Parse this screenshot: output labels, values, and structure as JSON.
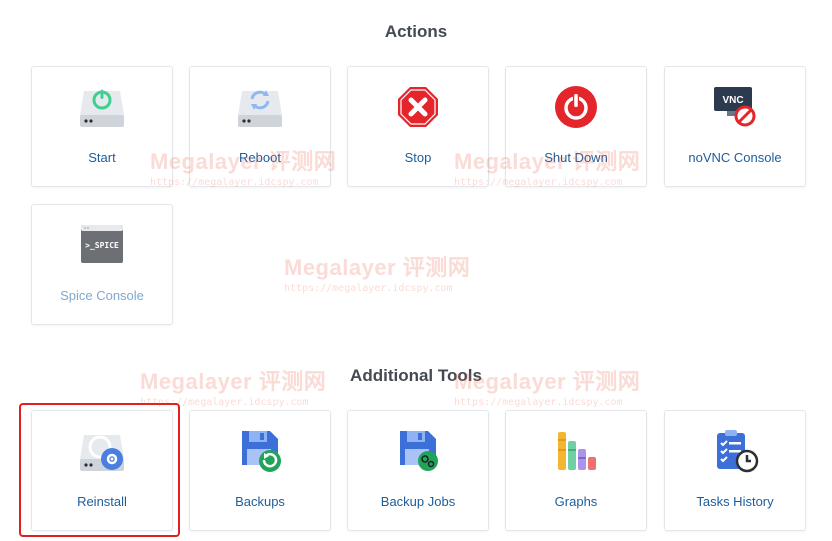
{
  "sections": {
    "actions_title": "Actions",
    "tools_title": "Additional Tools"
  },
  "actions": [
    {
      "label": "Start",
      "icon": "start-icon"
    },
    {
      "label": "Reboot",
      "icon": "reboot-icon"
    },
    {
      "label": "Stop",
      "icon": "stop-icon"
    },
    {
      "label": "Shut Down",
      "icon": "shutdown-icon"
    },
    {
      "label": "noVNC Console",
      "icon": "novnc-disabled-icon",
      "icon_text": "VNC"
    },
    {
      "label": "Spice Console",
      "icon": "spice-console-icon",
      "icon_text": ">_SPICE"
    }
  ],
  "tools": [
    {
      "label": "Reinstall",
      "icon": "reinstall-icon"
    },
    {
      "label": "Backups",
      "icon": "backups-icon"
    },
    {
      "label": "Backup Jobs",
      "icon": "backup-jobs-icon"
    },
    {
      "label": "Graphs",
      "icon": "graphs-icon"
    },
    {
      "label": "Tasks History",
      "icon": "tasks-history-icon"
    }
  ],
  "watermark": {
    "brand": "Megalayer 评测网",
    "url": "https://megalayer.idcspy.com"
  },
  "colors": {
    "label_blue": "#1d5d9b",
    "stop_red": "#e4252c",
    "start_green": "#3ecf8e",
    "highlight_red": "#e02020"
  }
}
